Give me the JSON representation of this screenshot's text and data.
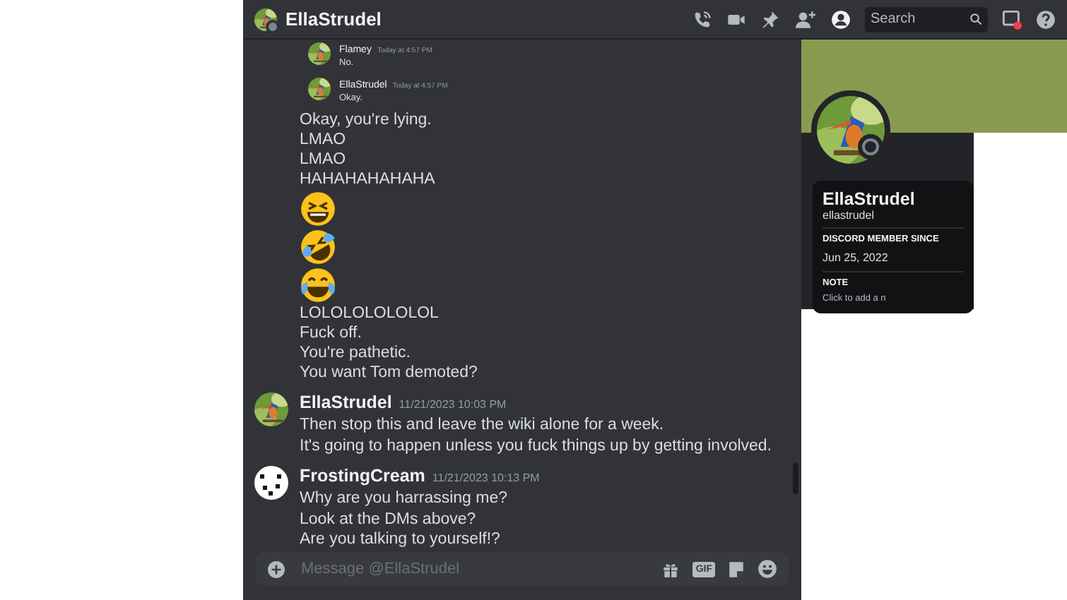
{
  "header": {
    "title": "EllaStrudel",
    "search": {
      "placeholder": "Search"
    }
  },
  "messages": [
    {
      "kind": "small",
      "author": "Flamey",
      "time": "Today at 4:57 PM",
      "avatar": {
        "kind": "picture"
      },
      "lines": [
        {
          "kind": "text",
          "text": "No."
        }
      ]
    },
    {
      "kind": "small",
      "author": "EllaStrudel",
      "time": "Today at 4:57 PM",
      "avatar": {
        "kind": "picture"
      },
      "lines": [
        {
          "kind": "text",
          "text": "Okay."
        }
      ]
    },
    {
      "kind": "continuation",
      "lines": [
        {
          "kind": "text",
          "text": "Okay, you're lying."
        },
        {
          "kind": "text",
          "text": "LMAO"
        },
        {
          "kind": "text",
          "text": "LMAO"
        },
        {
          "kind": "text",
          "text": "HAHAHAHAHAHA"
        },
        {
          "kind": "squint-emoji"
        },
        {
          "kind": "rolling-emoji"
        },
        {
          "kind": "tears-emoji"
        },
        {
          "kind": "text",
          "text": "LOLOLOLOLOLOL"
        },
        {
          "kind": "text",
          "text": "Fuck off."
        },
        {
          "kind": "text",
          "text": "You're pathetic."
        },
        {
          "kind": "text",
          "text": "You want Tom demoted?"
        }
      ]
    },
    {
      "kind": "normal",
      "author": "EllaStrudel",
      "time": "11/21/2023 10:03 PM",
      "avatar": {
        "kind": "picture"
      },
      "lines": [
        {
          "kind": "text",
          "text": "Then stop this and leave the wiki alone for a week."
        },
        {
          "kind": "text",
          "text": "It's going to happen unless you fuck things up by getting involved."
        }
      ]
    },
    {
      "kind": "normal",
      "author": "FrostingCream",
      "time": "11/21/2023 10:13 PM",
      "avatar": {
        "kind": "pattern"
      },
      "lines": [
        {
          "kind": "text",
          "text": "Why are you harrassing me?"
        },
        {
          "kind": "text",
          "text": "Look at the DMs above?"
        },
        {
          "kind": "text",
          "text": "Are you talking to yourself!?"
        }
      ]
    }
  ],
  "composer": {
    "placeholder": "Message @EllaStrudel",
    "gif_label": "GIF"
  },
  "profile": {
    "display_name": "EllaStrudel",
    "username": "ellastrudel",
    "member_since_label": "DISCORD MEMBER SINCE",
    "member_since": "Jun 25, 2022",
    "note_label": "NOTE",
    "note_placeholder": "Click to add a n"
  }
}
